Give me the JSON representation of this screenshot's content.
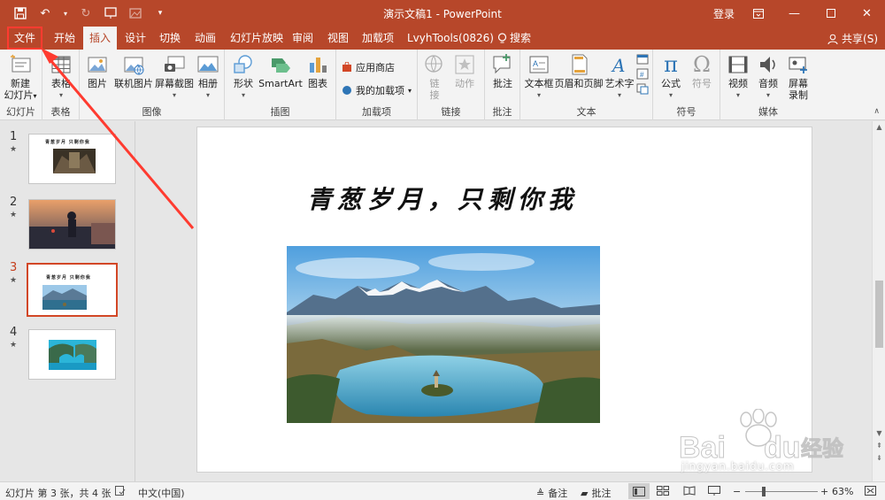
{
  "window": {
    "title": "演示文稿1 - PowerPoint",
    "login": "登录"
  },
  "tabs": {
    "file": "文件",
    "home": "开始",
    "insert": "插入",
    "design": "设计",
    "transitions": "切换",
    "animations": "动画",
    "slideshow": "幻灯片放映",
    "review": "审阅",
    "view": "视图",
    "addins": "加载项",
    "lvyh": "LvyhTools(0826)",
    "search": "搜索",
    "share": "共享(S)"
  },
  "ribbon": {
    "new_slide_1": "新建",
    "new_slide_2": "幻灯片",
    "slides_group": "幻灯片",
    "table": "表格",
    "tables_group": "表格",
    "picture": "图片",
    "online_picture": "联机图片",
    "screenshot": "屏幕截图",
    "album": "相册",
    "images_group": "图像",
    "shapes": "形状",
    "smartart": "SmartArt",
    "chart": "图表",
    "illustrations_group": "插图",
    "store": "应用商店",
    "my_addins": "我的加载项",
    "addins_group": "加载项",
    "link_1": "链",
    "link_2": "接",
    "action": "动作",
    "links_group": "链接",
    "comment": "批注",
    "comments_group": "批注",
    "textbox": "文本框",
    "header_footer": "页眉和页脚",
    "wordart": "艺术字",
    "text_group": "文本",
    "equation": "公式",
    "symbol": "符号",
    "symbols_group": "符号",
    "video": "视频",
    "audio": "音频",
    "screen_rec_1": "屏幕",
    "screen_rec_2": "录制",
    "media_group": "媒体"
  },
  "slides": [
    {
      "number": "1",
      "title": "青葱岁月  只剩你我"
    },
    {
      "number": "2"
    },
    {
      "number": "3",
      "title": "青葱岁月  只剩你我"
    },
    {
      "number": "4"
    }
  ],
  "main_slide": {
    "title": "青葱岁月，只剩你我"
  },
  "status": {
    "slide_info": "幻灯片 第 3 张，共 4 张",
    "language": "中文(中国)",
    "notes": "备注",
    "comments": "批注",
    "zoom": "63%"
  },
  "watermark": {
    "text": "jingyan.baidu.com",
    "logo_letters": "Bai du 经验"
  },
  "colors": {
    "accent": "#b7472a",
    "annotation": "#ff3b30"
  }
}
